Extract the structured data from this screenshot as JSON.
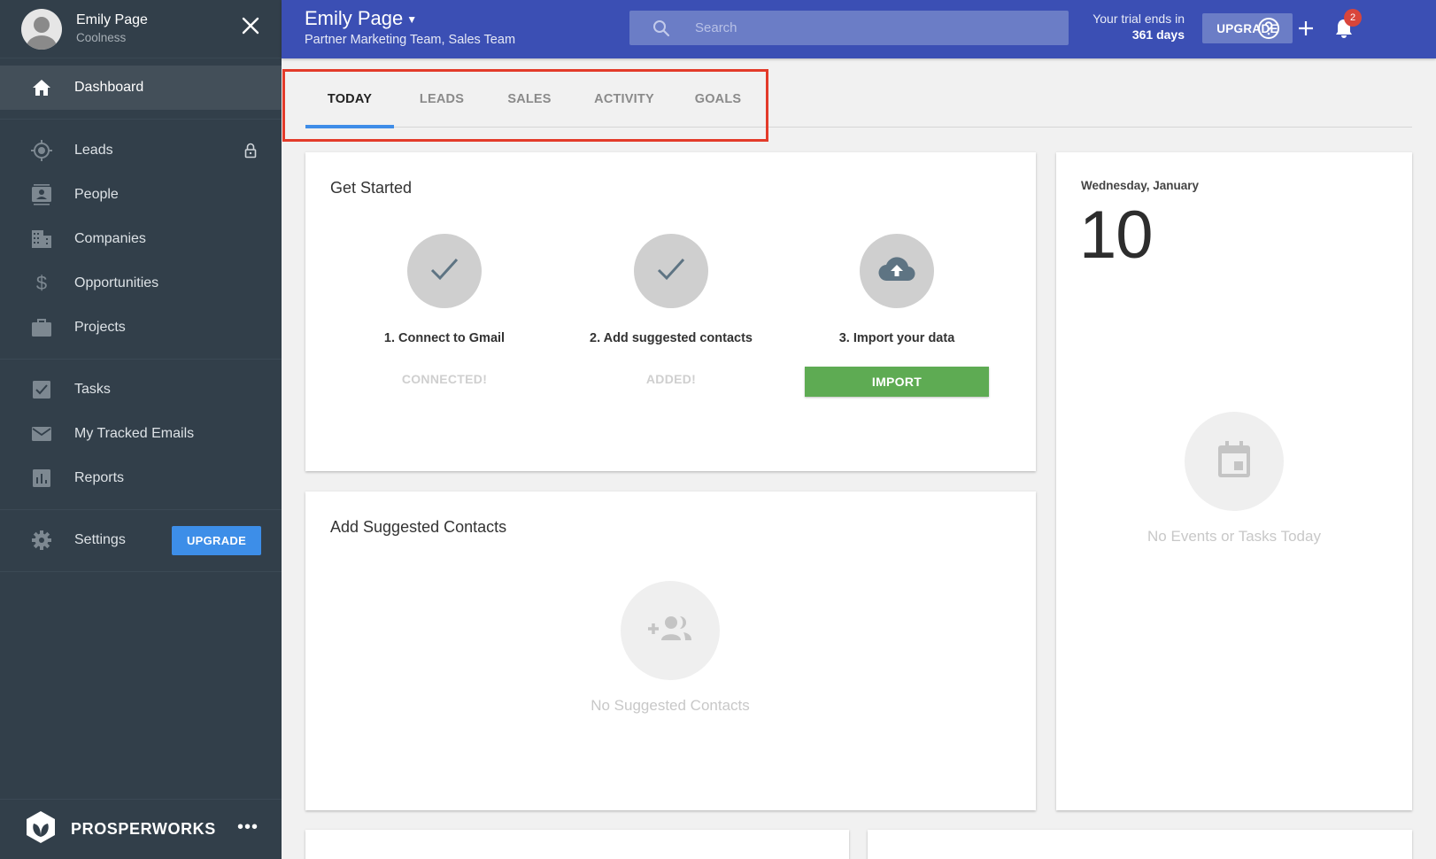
{
  "sidebar": {
    "user": {
      "name": "Emily Page",
      "subtitle": "Coolness"
    },
    "close_icon": "close-icon",
    "items": [
      {
        "label": "Dashboard",
        "icon": "home-icon",
        "active": true
      },
      {
        "label": "Leads",
        "icon": "target-icon",
        "locked": true
      },
      {
        "label": "People",
        "icon": "contact-card-icon"
      },
      {
        "label": "Companies",
        "icon": "building-icon"
      },
      {
        "label": "Opportunities",
        "icon": "dollar-icon"
      },
      {
        "label": "Projects",
        "icon": "briefcase-icon"
      },
      {
        "label": "Tasks",
        "icon": "checkbox-icon"
      },
      {
        "label": "My Tracked Emails",
        "icon": "envelope-icon"
      },
      {
        "label": "Reports",
        "icon": "bar-chart-icon"
      },
      {
        "label": "Settings",
        "icon": "gear-icon"
      }
    ],
    "upgrade_label": "UPGRADE",
    "brand": "PROSPERWORKS",
    "more_label": "•••"
  },
  "topbar": {
    "title": "Emily Page",
    "subtitle": "Partner Marketing Team, Sales Team",
    "search_placeholder": "Search",
    "trial_line1": "Your trial ends in",
    "trial_line2": "361 days",
    "upgrade_label": "UPGRADE",
    "notification_count": "2"
  },
  "tabs": [
    {
      "label": "TODAY",
      "active": true
    },
    {
      "label": "LEADS"
    },
    {
      "label": "SALES"
    },
    {
      "label": "ACTIVITY"
    },
    {
      "label": "GOALS"
    }
  ],
  "get_started": {
    "title": "Get Started",
    "steps": [
      {
        "label": "1.  Connect to Gmail",
        "status": "CONNECTED!",
        "icon": "checkmark-icon"
      },
      {
        "label": "2. Add suggested contacts",
        "status": "ADDED!",
        "icon": "checkmark-icon"
      },
      {
        "label": "3.  Import your data",
        "button": "IMPORT",
        "icon": "cloud-upload-icon"
      }
    ]
  },
  "suggested_contacts": {
    "title": "Add Suggested Contacts",
    "empty_text": "No Suggested Contacts"
  },
  "calendar": {
    "date_label": "Wednesday, January",
    "day": "10",
    "empty_text": "No Events or Tasks Today"
  },
  "colors": {
    "sidebar_bg": "#323f4a",
    "topbar_bg": "#3b4fb4",
    "accent_blue": "#3f8de8",
    "import_green": "#5eab53",
    "badge_red": "#d9453b",
    "highlight_red": "#e33b2a"
  }
}
